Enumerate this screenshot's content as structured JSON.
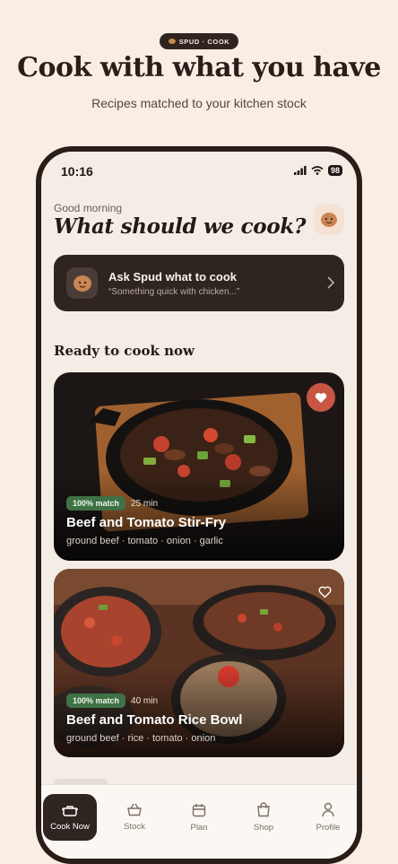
{
  "header": {
    "badge": "SPUD · COOK",
    "title": "Cook with what you have",
    "subtitle": "Recipes matched to your kitchen stock"
  },
  "status_bar": {
    "time": "10:16",
    "battery": "98"
  },
  "home": {
    "greeting": "Good morning",
    "question": "What should we cook?",
    "profile_icon": "potato-face-icon"
  },
  "ask": {
    "title": "Ask Spud what to cook",
    "placeholder": "“Something quick with chicken...”",
    "icon": "potato-face-icon"
  },
  "section_title": "Ready to cook now",
  "recipes": [
    {
      "match": "100% match",
      "time": "25 min",
      "title": "Beef and Tomato Stir-Fry",
      "ingredients": "ground beef · tomato · onion · garlic",
      "favorited": true
    },
    {
      "match": "100% match",
      "time": "40 min",
      "title": "Beef and Tomato Rice Bowl",
      "ingredients": "ground beef · rice · tomato · onion",
      "favorited": false
    }
  ],
  "tabs": [
    {
      "label": "Cook Now",
      "icon": "pot-icon",
      "active": true
    },
    {
      "label": "Stock",
      "icon": "basket-icon",
      "active": false
    },
    {
      "label": "Plan",
      "icon": "calendar-icon",
      "active": false
    },
    {
      "label": "Shop",
      "icon": "shopping-bag-icon",
      "active": false
    },
    {
      "label": "Profile",
      "icon": "person-icon",
      "active": false
    }
  ],
  "colors": {
    "page_bg": "#f8eee4",
    "phone_frame": "#2a1d18",
    "screen_bg": "#f3ede6",
    "dark_card": "#2e2420",
    "match_badge": "#3f7146",
    "favorite": "#c75645"
  }
}
